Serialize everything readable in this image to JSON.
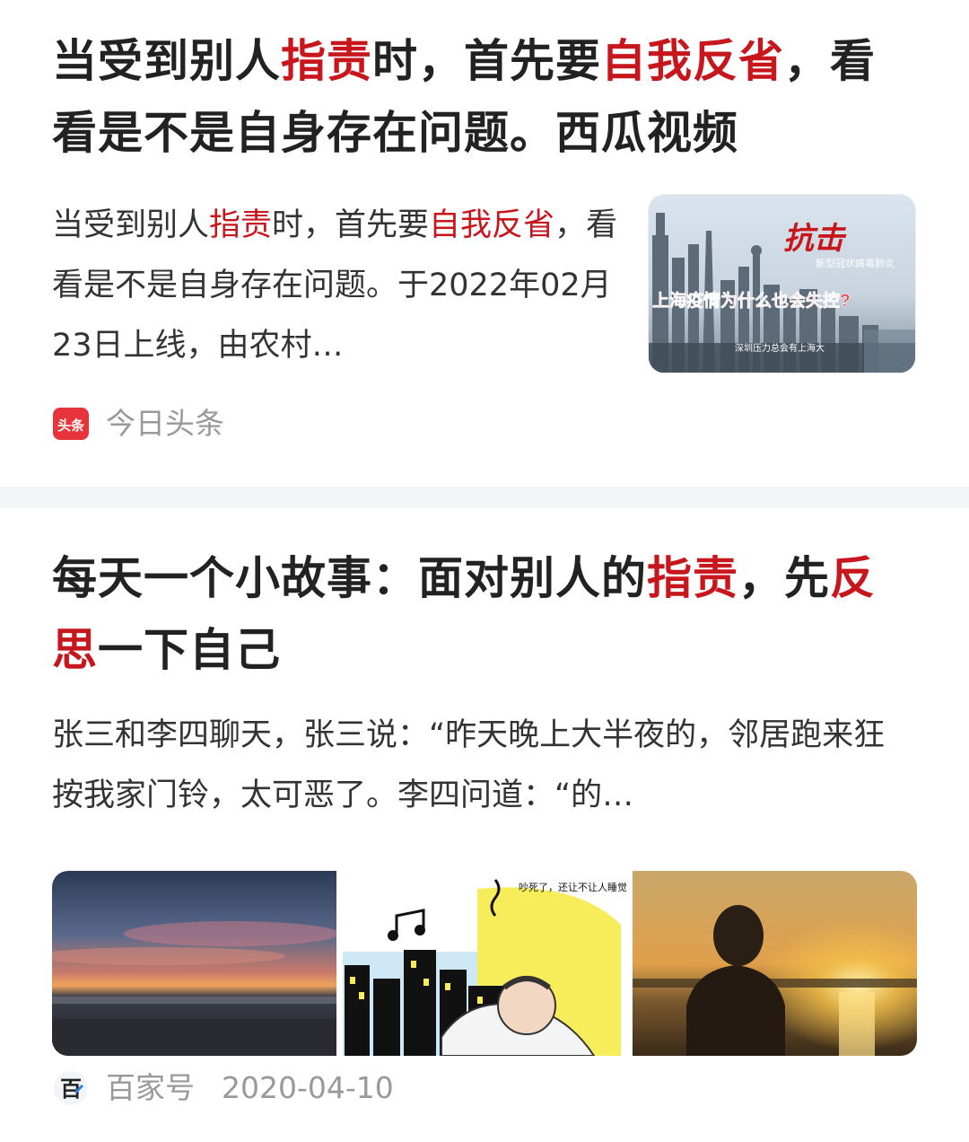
{
  "articles": [
    {
      "title": {
        "p1": "当受到别人",
        "h1": "指责",
        "p2": "时，首先要",
        "h2": "自我反省",
        "p3": "，看看是不是自身存在问题。西瓜视频"
      },
      "summary": {
        "p1": "当受到别人",
        "h1": "指责",
        "p2": "时，首先要",
        "h2": "自我反省",
        "p3": "，看看是不是自身存在问题。于2022年02月23日上线，由农村…"
      },
      "thumbnail": {
        "brush_title": "抗击",
        "subtitle": "新型冠状病毒肺炎",
        "headline": "上海疫情为什么也会失控?",
        "credit": "深圳压力总会有上海大"
      },
      "source_icon_text": "头条",
      "source": "今日头条"
    },
    {
      "title": {
        "p1": "每天一个小故事：面对别人的",
        "h1": "指责",
        "p2": "，先",
        "h2": "反思",
        "p3": "一下自己"
      },
      "summary": "张三和李四聊天，张三说：“昨天晚上大半夜的，邻居跑来狂按我家门铃，太可恶了。李四问道：“的…",
      "images": [
        {
          "name": "sunset-beach-image"
        },
        {
          "name": "noisy-neighbor-cartoon-image",
          "caption": "吵死了，还让不让人睡觉啊?"
        },
        {
          "name": "man-sunset-silhouette-image"
        }
      ],
      "source_icon_text": "百",
      "source": "百家号",
      "date": "2020-04-10"
    }
  ],
  "colors": {
    "highlight": "#c8161d",
    "title_text": "#222222",
    "meta_text": "#999999",
    "divider": "#f4f5f6"
  }
}
